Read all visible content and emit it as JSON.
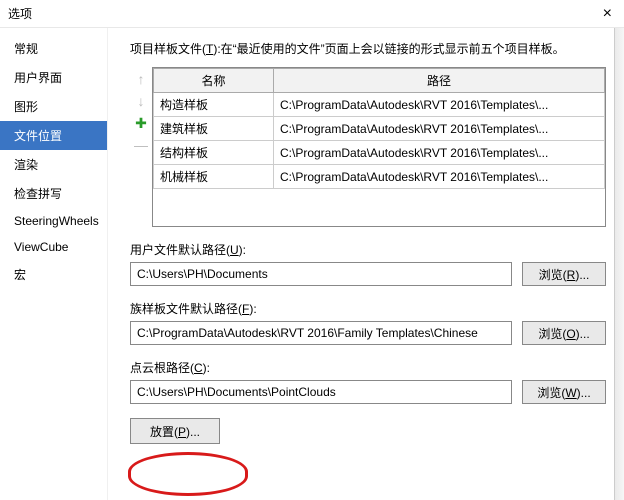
{
  "window": {
    "title": "选项",
    "close": "×"
  },
  "sidebar": {
    "items": [
      {
        "label": "常规"
      },
      {
        "label": "用户界面"
      },
      {
        "label": "图形"
      },
      {
        "label": "文件位置"
      },
      {
        "label": "渲染"
      },
      {
        "label": "检查拼写"
      },
      {
        "label": "SteeringWheels"
      },
      {
        "label": "ViewCube"
      },
      {
        "label": "宏"
      }
    ],
    "selectedIndex": 3
  },
  "intro": "项目样板文件(T):在“最近使用的文件”页面上会以链接的形式显示前五个项目样板。",
  "table": {
    "headers": {
      "name": "名称",
      "path": "路径"
    },
    "rows": [
      {
        "name": "构造样板",
        "path": "C:\\ProgramData\\Autodesk\\RVT 2016\\Templates\\..."
      },
      {
        "name": "建筑样板",
        "path": "C:\\ProgramData\\Autodesk\\RVT 2016\\Templates\\..."
      },
      {
        "name": "结构样板",
        "path": "C:\\ProgramData\\Autodesk\\RVT 2016\\Templates\\..."
      },
      {
        "name": "机械样板",
        "path": "C:\\ProgramData\\Autodesk\\RVT 2016\\Templates\\..."
      }
    ]
  },
  "tools": {
    "up": "↑",
    "down": "↓",
    "add": "✚",
    "remove": "—"
  },
  "fields": {
    "user": {
      "label": "用户文件默认路径(U):",
      "value": "C:\\Users\\PH\\Documents",
      "browse": "浏览(R)..."
    },
    "family": {
      "label": "族样板文件默认路径(F):",
      "value": "C:\\ProgramData\\Autodesk\\RVT 2016\\Family Templates\\Chinese",
      "browse": "浏览(O)..."
    },
    "pointcloud": {
      "label": "点云根路径(C):",
      "value": "C:\\Users\\PH\\Documents\\PointClouds",
      "browse": "浏览(W)..."
    }
  },
  "places": {
    "label": "放置(P)..."
  }
}
